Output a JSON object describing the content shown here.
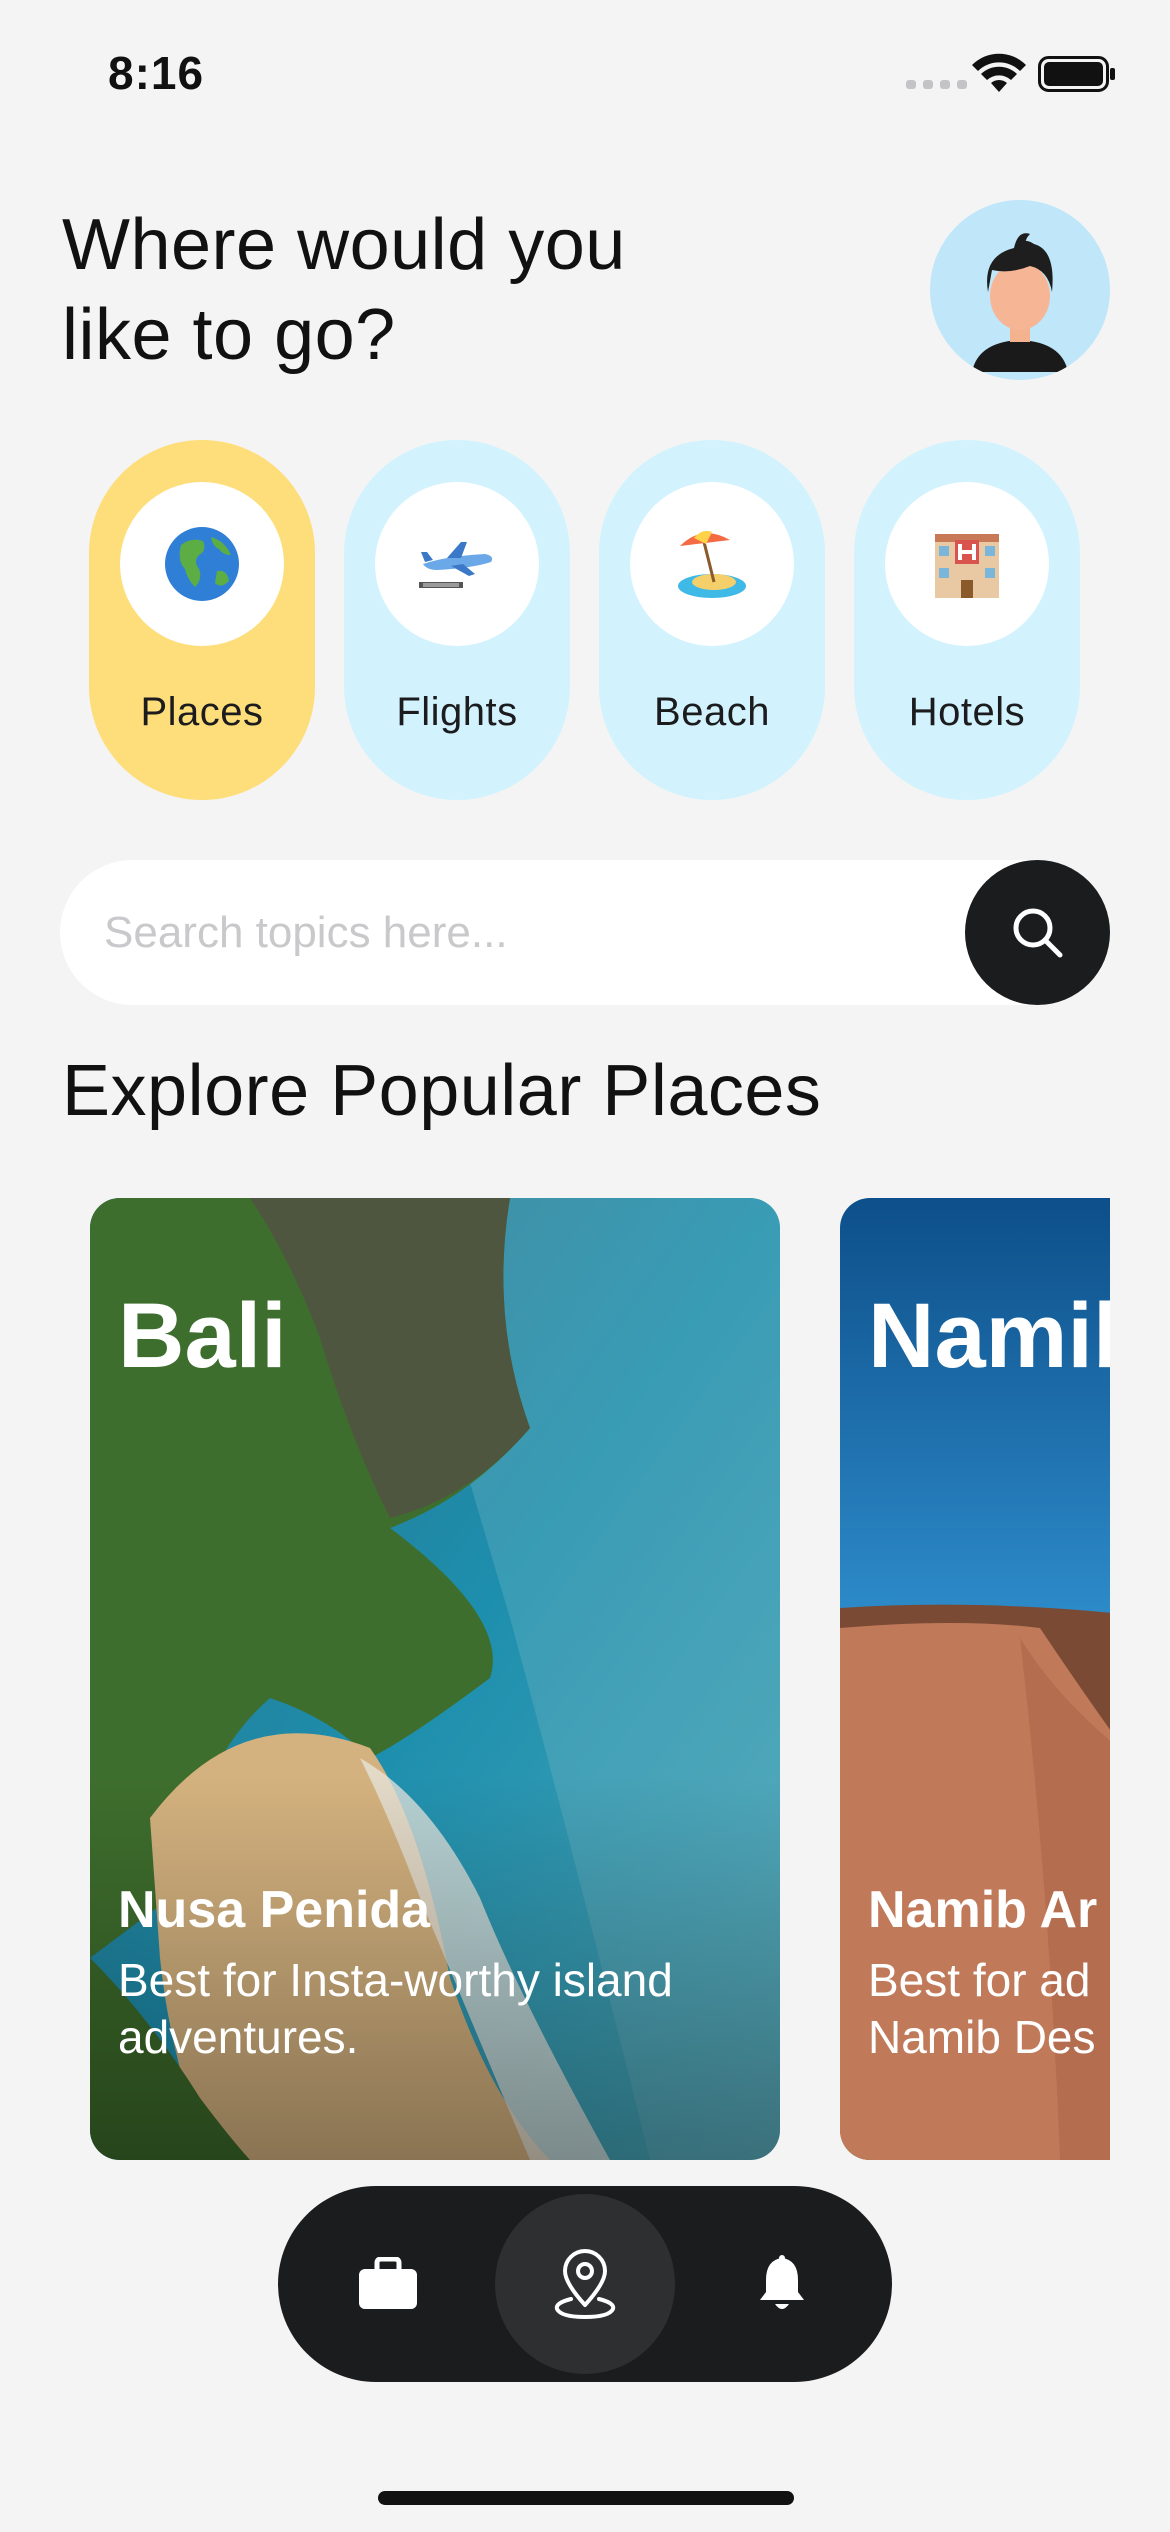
{
  "status_bar": {
    "time": "8:16"
  },
  "header": {
    "title_line1": "Where would you",
    "title_line2": "like to go?"
  },
  "categories": [
    {
      "label": "Places",
      "icon": "globe-icon",
      "active": true
    },
    {
      "label": "Flights",
      "icon": "airplane-icon",
      "active": false
    },
    {
      "label": "Beach",
      "icon": "beach-umbrella-icon",
      "active": false
    },
    {
      "label": "Hotels",
      "icon": "hotel-icon",
      "active": false
    }
  ],
  "search": {
    "placeholder": "Search topics here..."
  },
  "section": {
    "title": "Explore Popular Places"
  },
  "places": [
    {
      "name": "Bali",
      "spot": "Nusa Penida",
      "description": "Best for Insta-worthy island adventures."
    },
    {
      "name": "Namib",
      "spot": "Namib Ar",
      "description": "Best for ad Namib Des"
    }
  ],
  "nav": {
    "items": [
      "briefcase-icon",
      "map-pin-icon",
      "bell-icon"
    ],
    "active": "map-pin-icon"
  },
  "colors": {
    "active_category": "#fede7a",
    "category": "#d2f3fd",
    "dark": "#1b1c1e",
    "background": "#f4f4f5"
  }
}
